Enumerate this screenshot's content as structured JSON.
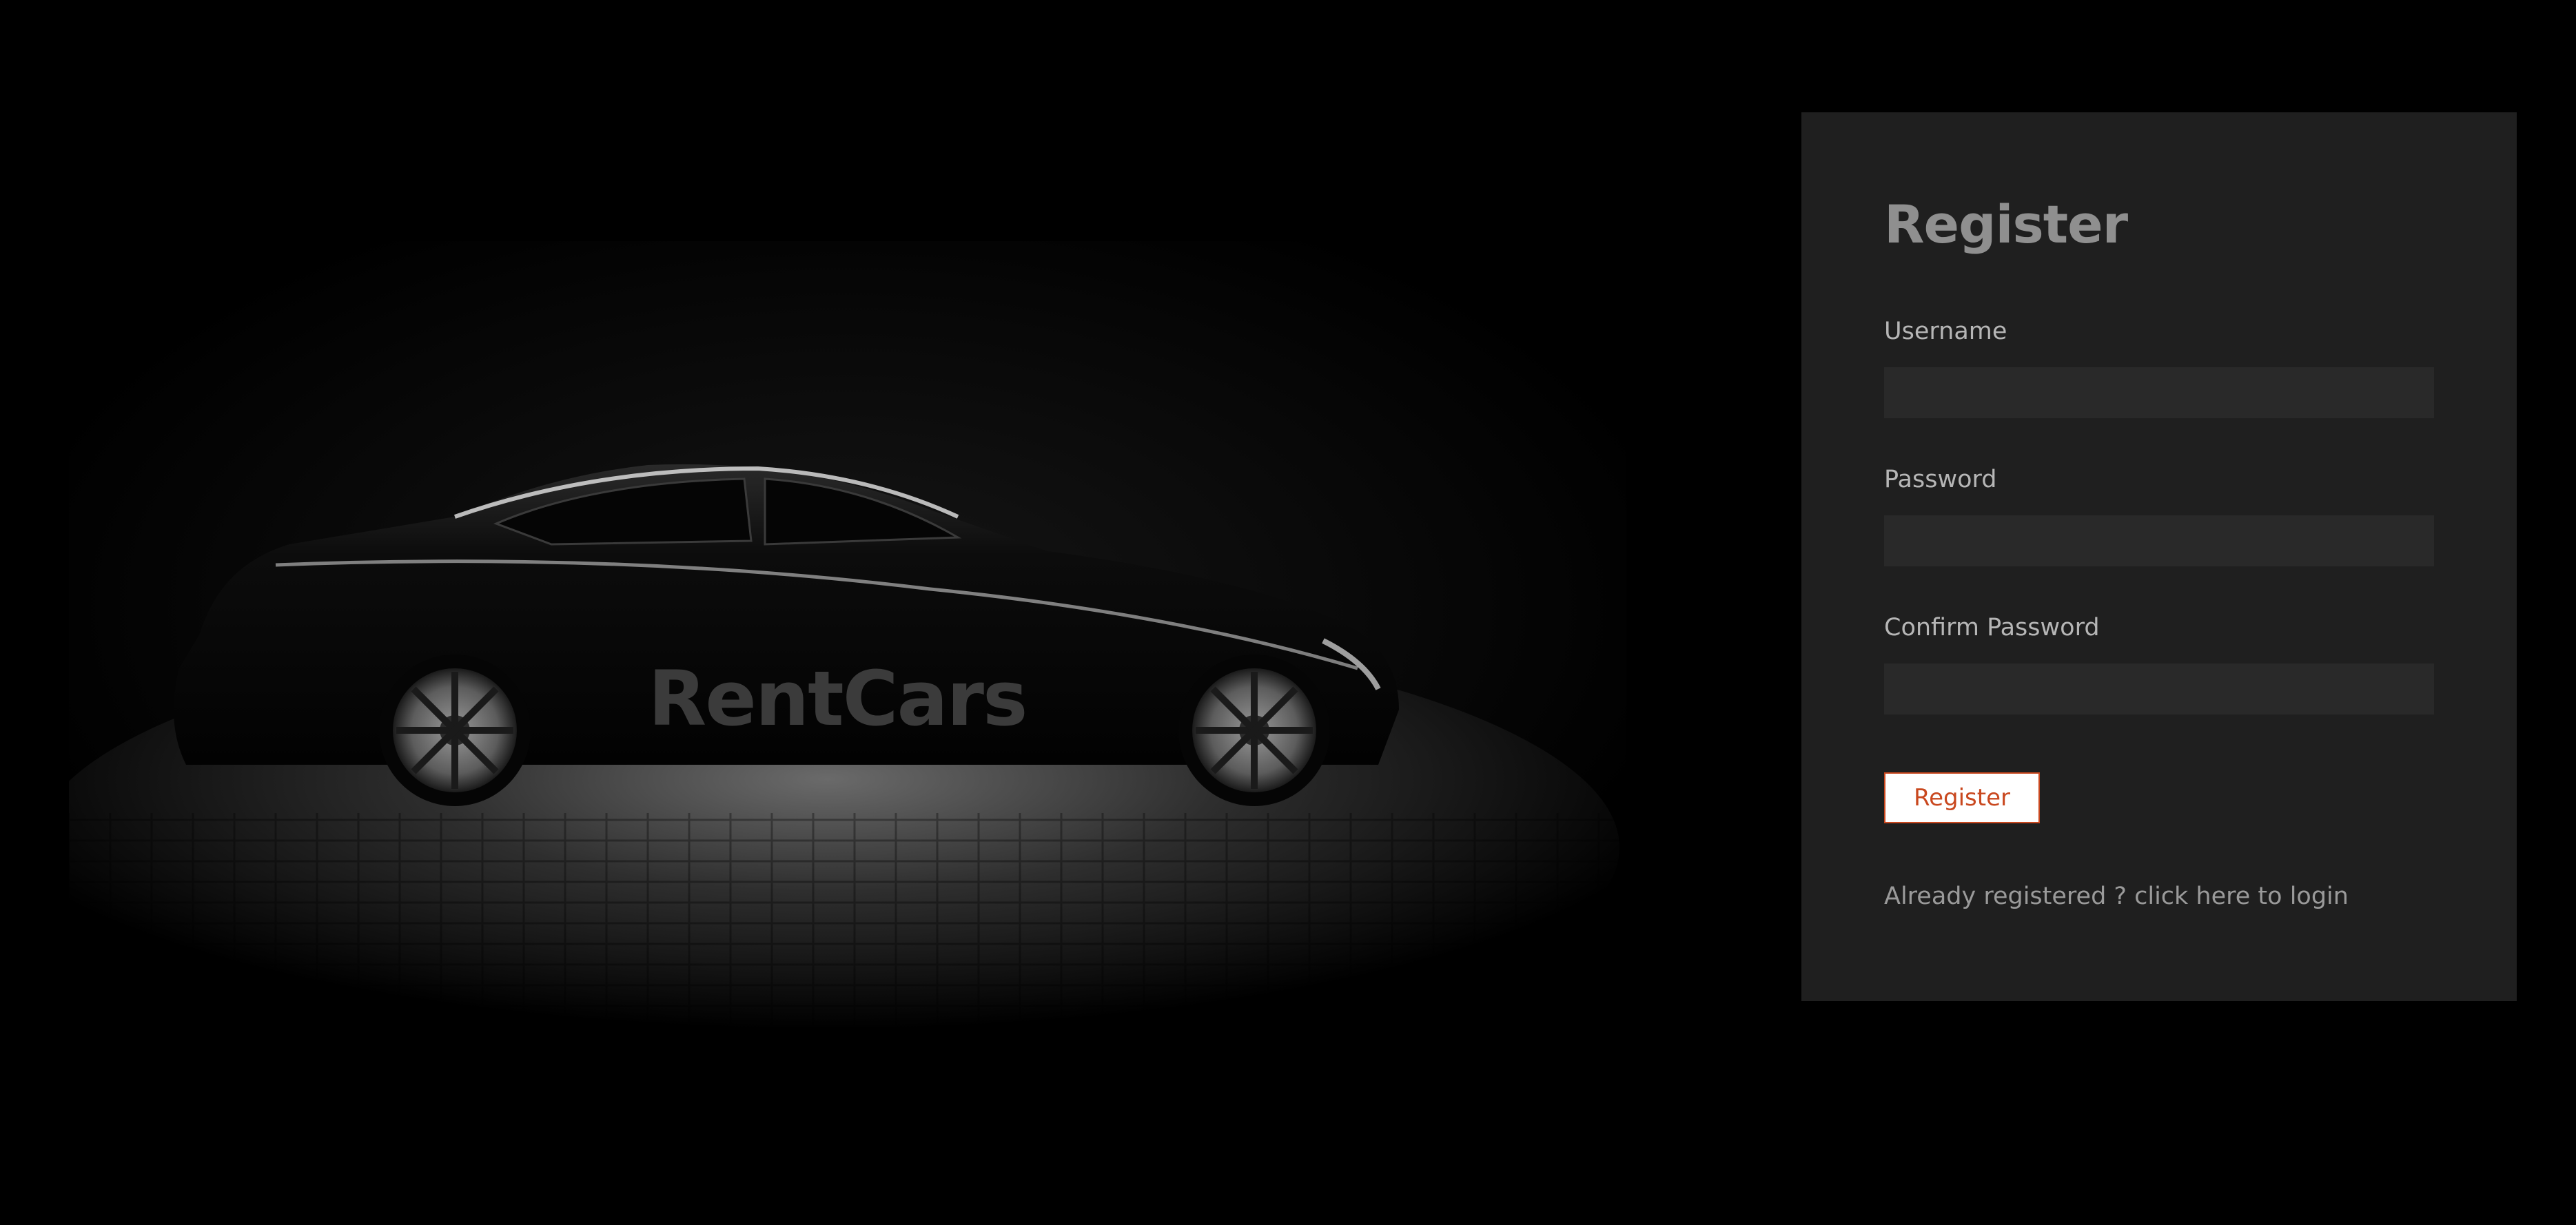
{
  "hero": {
    "brand": "RentCars",
    "image": "car-silhouette-photo"
  },
  "register_form": {
    "title": "Register",
    "username_label": "Username",
    "username_value": "",
    "password_label": "Password",
    "password_value": "",
    "confirm_label": "Confirm Password",
    "confirm_value": "",
    "submit_label": "Register",
    "login_link": "Already registered ? click here to login"
  },
  "colors": {
    "background": "#000000",
    "panel": "#1f1f1f",
    "input": "#292929",
    "accent": "#c9481f",
    "title_text": "#8f8f8f"
  }
}
